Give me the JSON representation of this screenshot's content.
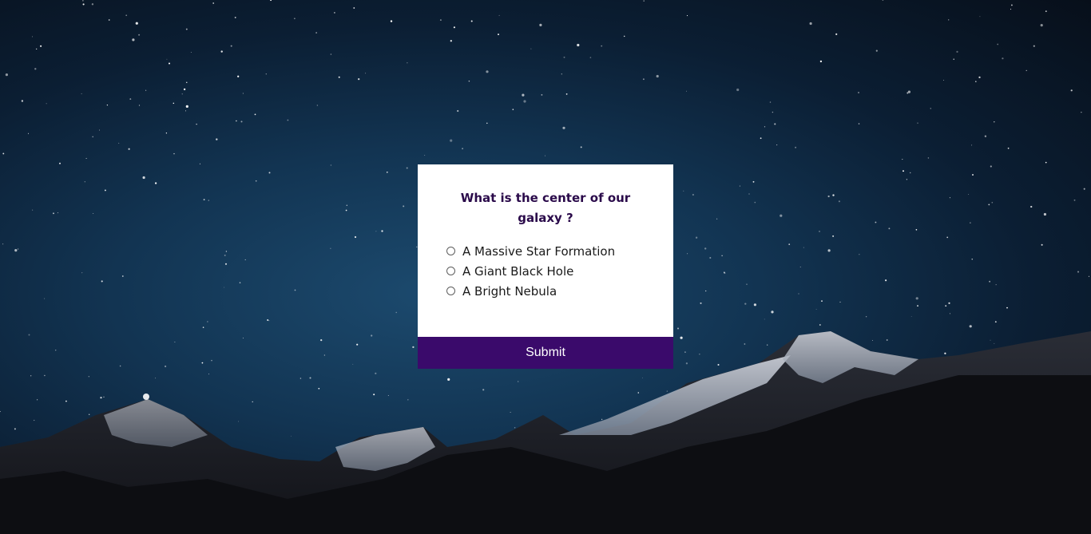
{
  "background": {
    "image": "starry-night-sky-over-snowy-mountains",
    "colors": {
      "sky_light": "#1c4a6e",
      "sky_dark": "#070f1a"
    }
  },
  "quiz": {
    "question": "What is the center of our galaxy ?",
    "options": [
      {
        "label": "A Massive Star Formation",
        "selected": false
      },
      {
        "label": "A Giant Black Hole",
        "selected": false
      },
      {
        "label": "A Bright Nebula",
        "selected": false
      }
    ],
    "submit_label": "Submit",
    "colors": {
      "question": "#2a0a4a",
      "submit_bg": "#3a0a6b",
      "submit_text": "#ffffff"
    }
  }
}
